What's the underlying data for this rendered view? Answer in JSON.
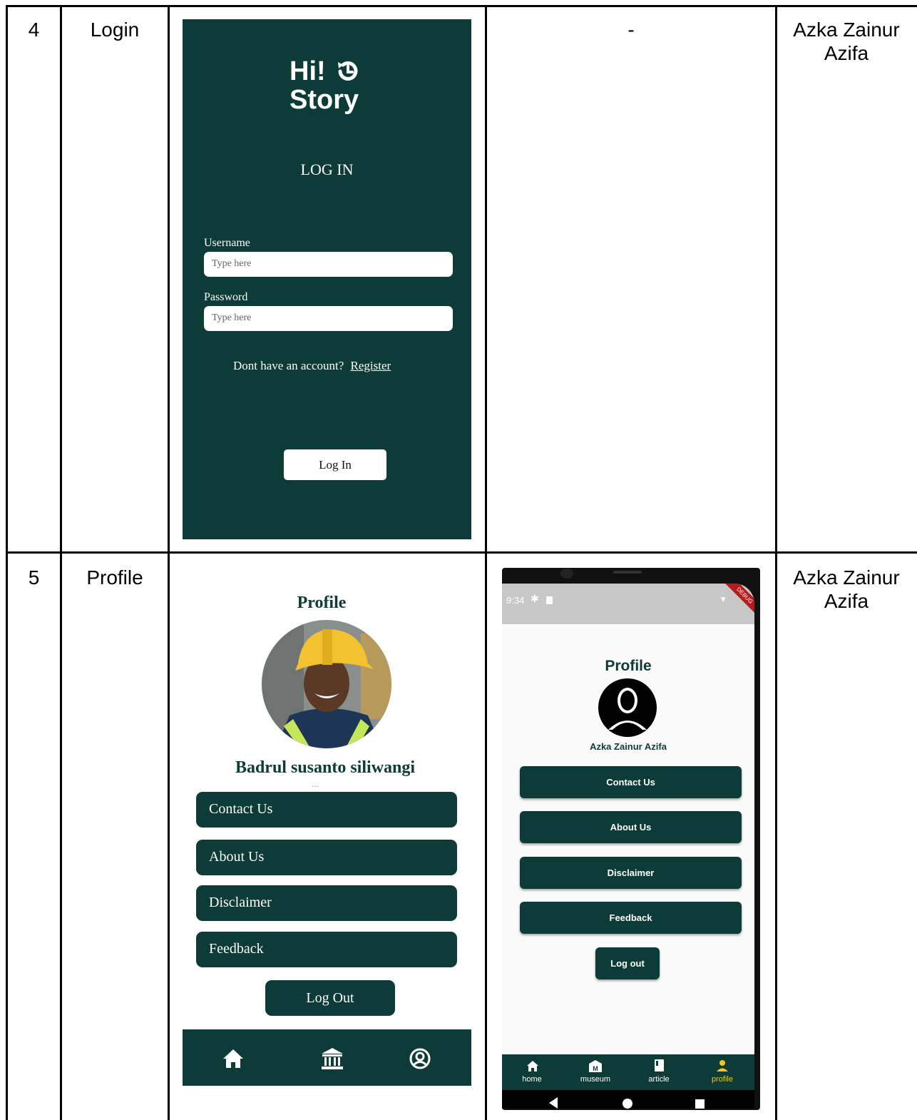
{
  "rows": [
    {
      "no": "4",
      "name": "Login",
      "design": {
        "logo_line1": "Hi!",
        "logo_line2": "Story",
        "heading": "LOG IN",
        "username_label": "Username",
        "username_placeholder": "Type here",
        "password_label": "Password",
        "password_placeholder": "Type here",
        "register_prompt": "Dont have an account?",
        "register_link": "Register",
        "login_button": "Log In"
      },
      "implementation": "-",
      "author": "Azka Zainur Azifa"
    },
    {
      "no": "5",
      "name": "Profile",
      "design": {
        "title": "Profile",
        "user_name": "Badrul susanto siliwangi",
        "dots": "...",
        "buttons": [
          "Contact Us",
          "About Us",
          "Disclaimer",
          "Feedback"
        ],
        "logout": "Log Out",
        "nav_icons": [
          "home-icon",
          "museum-icon",
          "account-circle-icon"
        ]
      },
      "implementation": {
        "status_time": "9:34",
        "debug_banner": "DEBUG",
        "title": "Profile",
        "user_name": "Azka Zainur Azifa",
        "buttons": [
          "Contact Us",
          "About Us",
          "Disclaimer",
          "Feedback"
        ],
        "logout": "Log out",
        "nav": [
          {
            "label": "home",
            "icon": "home-icon"
          },
          {
            "label": "museum",
            "icon": "museum-icon"
          },
          {
            "label": "article",
            "icon": "book-icon"
          },
          {
            "label": "profile",
            "icon": "person-icon"
          }
        ],
        "active_nav_color": "#f5c518"
      },
      "author": "Azka Zainur Azifa"
    }
  ],
  "colors": {
    "brand": "#0d3b37",
    "page_bg": "#ffffff",
    "app_bg": "#fafafa"
  }
}
